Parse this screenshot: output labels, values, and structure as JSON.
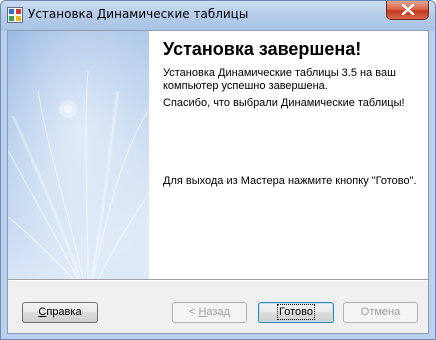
{
  "window": {
    "title": "Установка Динамические таблицы"
  },
  "content": {
    "heading": "Установка завершена!",
    "paragraph1": "Установка Динамические таблицы 3.5 на ваш компьютер успешно завершена.",
    "paragraph2": "Спасибо, что выбрали Динамические таблицы!",
    "paragraph3": "Для выхода из Мастера нажмите кнопку \"Готово\"."
  },
  "buttons": {
    "help": {
      "mnemonic": "С",
      "rest": "правка",
      "enabled": true
    },
    "back": {
      "prefix": "< ",
      "mnemonic": "Н",
      "rest": "азад",
      "enabled": false
    },
    "finish": {
      "label": "Готово",
      "enabled": true,
      "default": true
    },
    "cancel": {
      "label": "Отмена",
      "enabled": false
    }
  },
  "icons": {
    "app": "installer-app-icon",
    "close": "close-icon"
  },
  "colors": {
    "title_bar": "#b6cde9",
    "client_bg": "#f0f0f0",
    "content_bg": "#ffffff",
    "side_panel_top": "#a5c2e6",
    "side_panel_bottom": "#dde9f7",
    "close_button": "#c9432a"
  }
}
